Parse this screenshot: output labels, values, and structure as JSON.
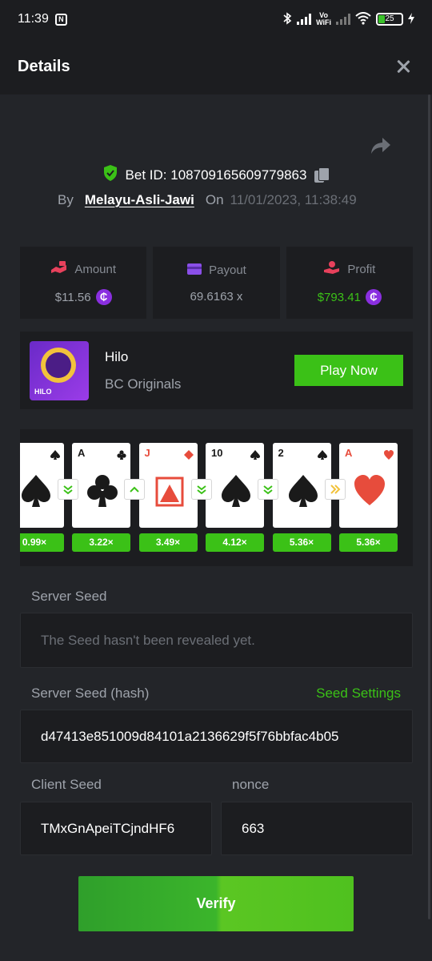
{
  "status_bar": {
    "time": "11:39",
    "vo": "Vo",
    "wifi_label": "WiFi",
    "battery": "25"
  },
  "header": {
    "title": "Details"
  },
  "bet": {
    "id_label": "Bet ID:",
    "id": "108709165609779863",
    "by_label": "By",
    "user": "Melayu-Asli-Jawi",
    "on_label": "On",
    "datetime": "11/01/2023, 11:38:49"
  },
  "stats": {
    "amount": {
      "label": "Amount",
      "value": "$11.56"
    },
    "payout": {
      "label": "Payout",
      "value": "69.6163 x"
    },
    "profit": {
      "label": "Profit",
      "value": "$793.41"
    },
    "coin_symbol": "₵"
  },
  "game": {
    "title": "Hilo",
    "provider": "BC Originals",
    "play_label": "Play Now",
    "thumb_label": "HILO"
  },
  "cards": [
    {
      "rank": "",
      "suit": "spade",
      "red": false,
      "multiplier": "0.99×"
    },
    {
      "rank": "A",
      "suit": "club",
      "red": false,
      "multiplier": "3.22×"
    },
    {
      "rank": "J",
      "suit": "diamond",
      "red": true,
      "multiplier": "3.49×"
    },
    {
      "rank": "10",
      "suit": "spade",
      "red": false,
      "multiplier": "4.12×"
    },
    {
      "rank": "2",
      "suit": "spade",
      "red": false,
      "multiplier": "5.36×"
    },
    {
      "rank": "A",
      "suit": "heart",
      "red": true,
      "multiplier": "5.36×"
    }
  ],
  "arrows": [
    "lower-icon",
    "higher-icon",
    "lower-icon",
    "lower-icon",
    "skip-icon"
  ],
  "server_seed": {
    "label": "Server Seed",
    "value": "The Seed hasn't been revealed yet."
  },
  "server_seed_hash": {
    "label": "Server Seed (hash)",
    "settings_label": "Seed Settings",
    "value": "d47413e851009d84101a2136629f5f76bbfac4b05"
  },
  "client_seed": {
    "label": "Client Seed",
    "value": "TMxGnApeiTCjndHF6"
  },
  "nonce": {
    "label": "nonce",
    "value": "663"
  },
  "verify_label": "Verify",
  "colors": {
    "accent": "#3bc117",
    "panel": "#1c1d20",
    "bg": "#232529",
    "coin": "#8a2fe0"
  }
}
